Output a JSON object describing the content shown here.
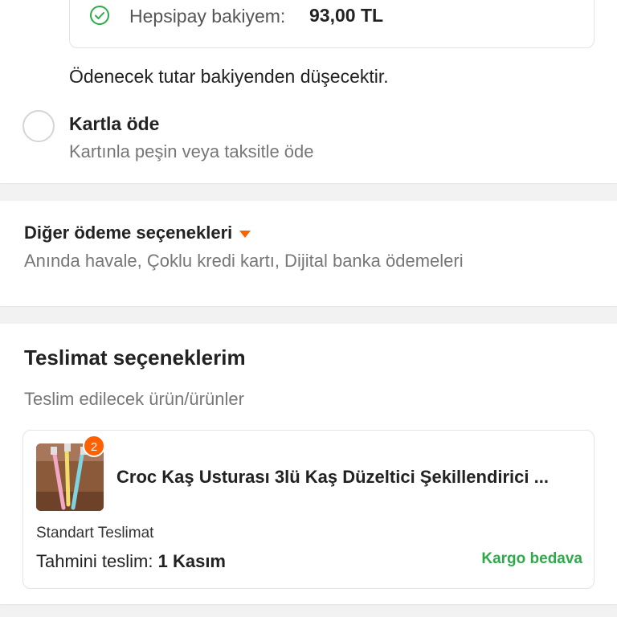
{
  "payment": {
    "balance_label": "Hepsipay bakiyem:",
    "balance_value": "93,00 TL",
    "deduct_note": "Ödenecek tutar bakiyenden düşecektir.",
    "card_option": {
      "title": "Kartla öde",
      "subtitle": "Kartınla peşin veya taksitle öde"
    }
  },
  "other_options": {
    "title": "Diğer ödeme seçenekleri",
    "subtitle": "Anında havale, Çoklu kredi kartı, Dijital banka ödemeleri"
  },
  "delivery": {
    "title": "Teslimat seçeneklerim",
    "subtitle": "Teslim edilecek ürün/ürünler",
    "product": {
      "quantity": "2",
      "name": "Croc Kaş Usturası 3lü Kaş Düzeltici Şekillendirici ...",
      "shipping_type": "Standart Teslimat",
      "estimate_label": "Tahmini teslim:",
      "estimate_date": "1 Kasım",
      "shipping_cost": "Kargo bedava"
    }
  },
  "colors": {
    "accent": "#ff6000",
    "success": "#2eaa4a",
    "check_icon": "#2eaa4a"
  },
  "icons": {
    "balance": "check-circle-icon",
    "other_options_toggle": "triangle-down-icon"
  }
}
